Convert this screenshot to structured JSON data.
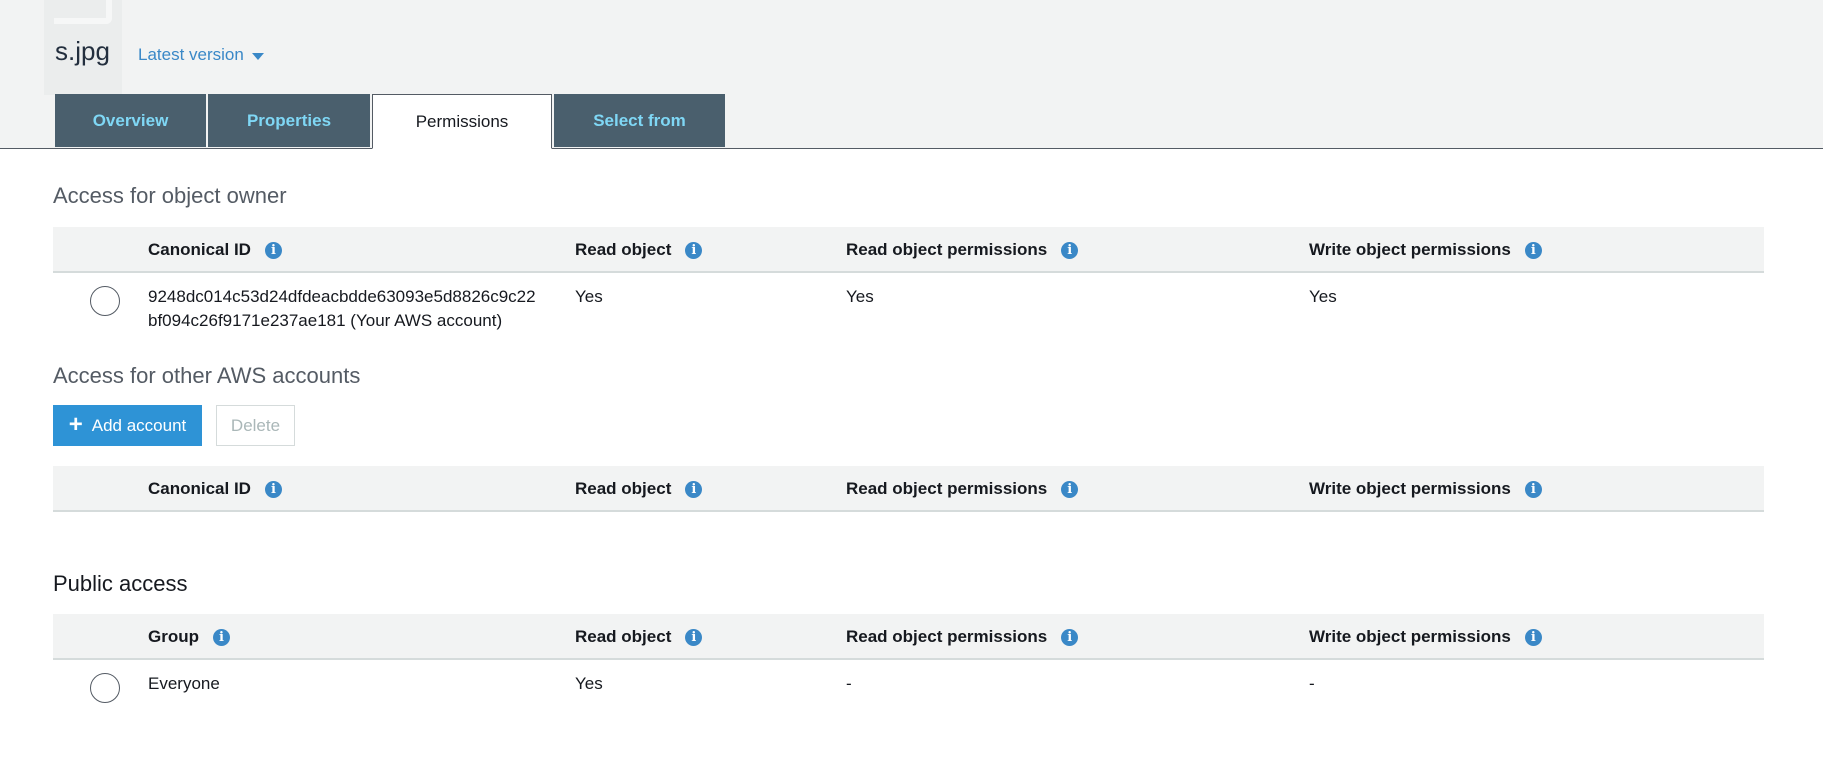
{
  "header": {
    "file_name": "s.jpg",
    "version_label": "Latest version"
  },
  "tabs": [
    {
      "label": "Overview",
      "active": false
    },
    {
      "label": "Properties",
      "active": false
    },
    {
      "label": "Permissions",
      "active": true
    },
    {
      "label": "Select from",
      "active": false
    }
  ],
  "owner_section": {
    "title": "Access for object owner",
    "columns": [
      "Canonical ID",
      "Read object",
      "Read object permissions",
      "Write object permissions"
    ],
    "rows": [
      {
        "id_line1": "9248dc014c53d24dfdeacbdde63093e5d8826c9c22",
        "id_line2": "bf094c26f9171e237ae181 (Your AWS account)",
        "read_object": "Yes",
        "read_permissions": "Yes",
        "write_permissions": "Yes"
      }
    ]
  },
  "other_accounts_section": {
    "title": "Access for other AWS accounts",
    "add_button": "Add account",
    "delete_button": "Delete",
    "columns": [
      "Canonical ID",
      "Read object",
      "Read object permissions",
      "Write object permissions"
    ]
  },
  "public_section": {
    "title": "Public access",
    "columns": [
      "Group",
      "Read object",
      "Read object permissions",
      "Write object permissions"
    ],
    "rows": [
      {
        "group": "Everyone",
        "read_object": "Yes",
        "read_permissions": "-",
        "write_permissions": "-"
      }
    ]
  },
  "icons": {
    "info": "i"
  },
  "colors": {
    "accent": "#2e93d6",
    "tab_bg": "#4a5f6d",
    "tab_text": "#7fd7f5",
    "link": "#3a88c7"
  }
}
